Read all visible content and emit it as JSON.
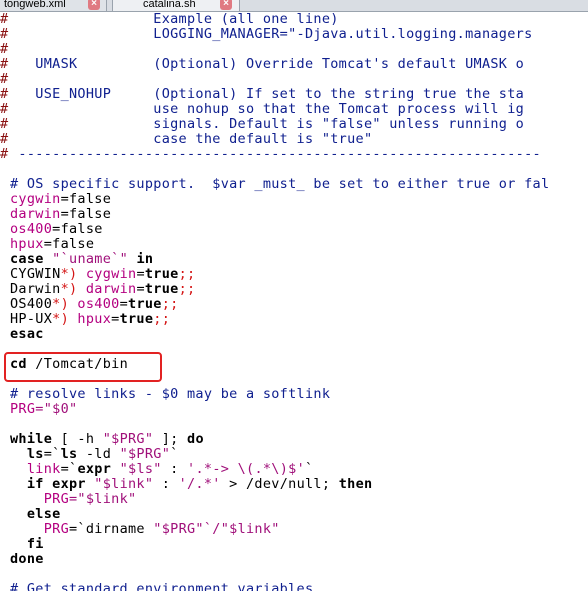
{
  "tabs": [
    {
      "label": "tongweb.xml",
      "close": "×"
    },
    {
      "label": "catalina.sh",
      "close": "×"
    }
  ],
  "lines": [
    {
      "ln": "#",
      "segs": [
        {
          "t": "                 Example (all one line)",
          "c": "c"
        }
      ]
    },
    {
      "ln": "#",
      "segs": [
        {
          "t": "                 LOGGING_MANAGER=\"-Djava.util.logging.managers",
          "c": "c"
        }
      ]
    },
    {
      "ln": "#",
      "segs": [
        {
          "t": "",
          "c": "c"
        }
      ]
    },
    {
      "ln": "#",
      "segs": [
        {
          "t": "   UMASK         (Optional) Override Tomcat's default UMASK o",
          "c": "c"
        }
      ]
    },
    {
      "ln": "#",
      "segs": [
        {
          "t": "",
          "c": "c"
        }
      ]
    },
    {
      "ln": "#",
      "segs": [
        {
          "t": "   USE_NOHUP     (Optional) If set to the string true the sta",
          "c": "c"
        }
      ]
    },
    {
      "ln": "#",
      "segs": [
        {
          "t": "                 use nohup so that the Tomcat process will ig",
          "c": "c"
        }
      ]
    },
    {
      "ln": "#",
      "segs": [
        {
          "t": "                 signals. Default is \"false\" unless running o",
          "c": "c"
        }
      ]
    },
    {
      "ln": "#",
      "segs": [
        {
          "t": "                 case the default is \"true\"",
          "c": "c"
        }
      ]
    },
    {
      "ln": "#",
      "segs": [
        {
          "t": " --------------------------------------------------------------",
          "c": "c"
        }
      ]
    },
    {
      "ln": "",
      "segs": []
    },
    {
      "ln": "",
      "segs": [
        {
          "t": "# OS specific support.  $var _must_ be set to either true or fal",
          "c": "c"
        }
      ]
    },
    {
      "ln": "",
      "segs": [
        {
          "t": "cygwin",
          "c": "v"
        },
        {
          "t": "=false",
          "c": "s"
        }
      ]
    },
    {
      "ln": "",
      "segs": [
        {
          "t": "darwin",
          "c": "v"
        },
        {
          "t": "=false",
          "c": "s"
        }
      ]
    },
    {
      "ln": "",
      "segs": [
        {
          "t": "os400",
          "c": "v"
        },
        {
          "t": "=false",
          "c": "s"
        }
      ]
    },
    {
      "ln": "",
      "segs": [
        {
          "t": "hpux",
          "c": "v"
        },
        {
          "t": "=false",
          "c": "s"
        }
      ]
    },
    {
      "ln": "",
      "segs": [
        {
          "t": "case",
          "c": "k"
        },
        {
          "t": " \"`",
          "c": "st"
        },
        {
          "t": "uname",
          "c": "st"
        },
        {
          "t": "`\" ",
          "c": "st"
        },
        {
          "t": "in",
          "c": "k"
        }
      ]
    },
    {
      "ln": "",
      "segs": [
        {
          "t": "CYGWIN",
          "c": "s"
        },
        {
          "t": "*)",
          "c": "r"
        },
        {
          "t": " cygwin",
          "c": "v"
        },
        {
          "t": "=",
          "c": "s"
        },
        {
          "t": "true",
          "c": "k"
        },
        {
          "t": ";;",
          "c": "r"
        }
      ]
    },
    {
      "ln": "",
      "segs": [
        {
          "t": "Darwin",
          "c": "s"
        },
        {
          "t": "*)",
          "c": "r"
        },
        {
          "t": " darwin",
          "c": "v"
        },
        {
          "t": "=",
          "c": "s"
        },
        {
          "t": "true",
          "c": "k"
        },
        {
          "t": ";;",
          "c": "r"
        }
      ]
    },
    {
      "ln": "",
      "segs": [
        {
          "t": "OS400",
          "c": "s"
        },
        {
          "t": "*)",
          "c": "r"
        },
        {
          "t": " os400",
          "c": "v"
        },
        {
          "t": "=",
          "c": "s"
        },
        {
          "t": "true",
          "c": "k"
        },
        {
          "t": ";;",
          "c": "r"
        }
      ]
    },
    {
      "ln": "",
      "segs": [
        {
          "t": "HP-UX",
          "c": "s"
        },
        {
          "t": "*)",
          "c": "r"
        },
        {
          "t": " hpux",
          "c": "v"
        },
        {
          "t": "=",
          "c": "s"
        },
        {
          "t": "true",
          "c": "k"
        },
        {
          "t": ";;",
          "c": "r"
        }
      ]
    },
    {
      "ln": "",
      "segs": [
        {
          "t": "esac",
          "c": "k"
        }
      ]
    },
    {
      "ln": "",
      "segs": []
    },
    {
      "ln": "",
      "segs": [
        {
          "t": "cd",
          "c": "k"
        },
        {
          "t": " /Tomcat/bin",
          "c": "s"
        }
      ]
    },
    {
      "ln": "",
      "segs": []
    },
    {
      "ln": "",
      "segs": [
        {
          "t": "# resolve links - $0 may be a softlink",
          "c": "c"
        }
      ]
    },
    {
      "ln": "",
      "segs": [
        {
          "t": "PRG",
          "c": "v"
        },
        {
          "t": "=\"$0\"",
          "c": "st"
        }
      ]
    },
    {
      "ln": "",
      "segs": []
    },
    {
      "ln": "",
      "segs": [
        {
          "t": "while",
          "c": "k"
        },
        {
          "t": " [ -h ",
          "c": "s"
        },
        {
          "t": "\"$PRG\"",
          "c": "st"
        },
        {
          "t": " ]; ",
          "c": "s"
        },
        {
          "t": "do",
          "c": "k"
        }
      ]
    },
    {
      "ln": "",
      "segs": [
        {
          "t": "  ls",
          "c": "k"
        },
        {
          "t": "=`",
          "c": "s"
        },
        {
          "t": "ls",
          "c": "k"
        },
        {
          "t": " -ld ",
          "c": "s"
        },
        {
          "t": "\"$PRG\"",
          "c": "st"
        },
        {
          "t": "`",
          "c": "s"
        }
      ]
    },
    {
      "ln": "",
      "segs": [
        {
          "t": "  link",
          "c": "v"
        },
        {
          "t": "=`",
          "c": "s"
        },
        {
          "t": "expr",
          "c": "k"
        },
        {
          "t": " \"$ls\"",
          "c": "st"
        },
        {
          "t": " : ",
          "c": "s"
        },
        {
          "t": "'.*-> \\(.*\\)$'",
          "c": "st"
        },
        {
          "t": "`",
          "c": "s"
        }
      ]
    },
    {
      "ln": "",
      "segs": [
        {
          "t": "  if expr",
          "c": "k"
        },
        {
          "t": " \"$link\"",
          "c": "st"
        },
        {
          "t": " : ",
          "c": "s"
        },
        {
          "t": "'/.*'",
          "c": "st"
        },
        {
          "t": " > /dev/null; ",
          "c": "s"
        },
        {
          "t": "then",
          "c": "k"
        }
      ]
    },
    {
      "ln": "",
      "segs": [
        {
          "t": "    PRG",
          "c": "v"
        },
        {
          "t": "=\"$link\"",
          "c": "st"
        }
      ]
    },
    {
      "ln": "",
      "segs": [
        {
          "t": "  else",
          "c": "k"
        }
      ]
    },
    {
      "ln": "",
      "segs": [
        {
          "t": "    PRG",
          "c": "v"
        },
        {
          "t": "=`",
          "c": "s"
        },
        {
          "t": "dirname",
          "c": "s"
        },
        {
          "t": " \"$PRG\"",
          "c": "st"
        },
        {
          "t": "`/\"$link\"",
          "c": "st"
        }
      ]
    },
    {
      "ln": "",
      "segs": [
        {
          "t": "  fi",
          "c": "k"
        }
      ]
    },
    {
      "ln": "",
      "segs": [
        {
          "t": "done",
          "c": "k"
        }
      ]
    },
    {
      "ln": "",
      "segs": []
    },
    {
      "ln": "",
      "segs": [
        {
          "t": "# Get standard environment variables",
          "c": "c"
        }
      ]
    }
  ]
}
